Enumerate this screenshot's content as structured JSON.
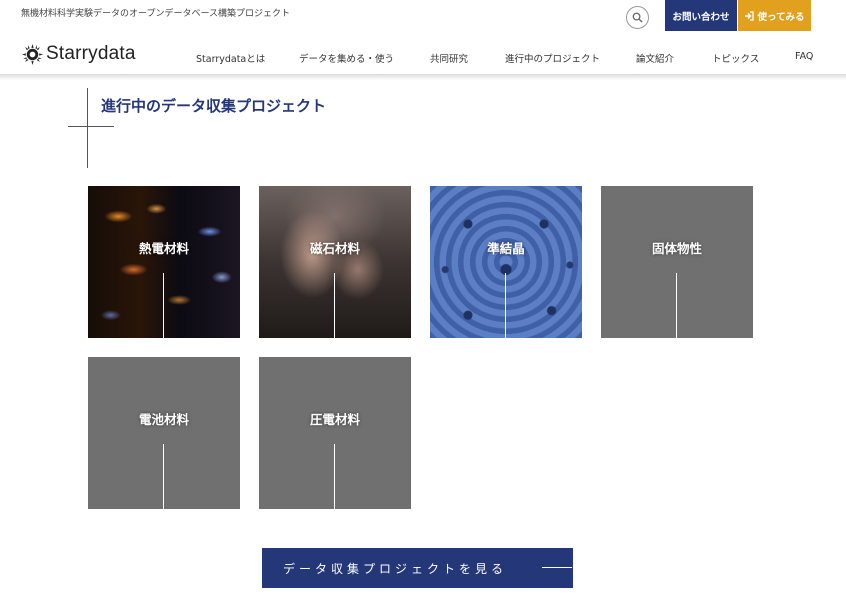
{
  "header": {
    "tagline": "無機材料科学実験データのオープンデータベース構築プロジェクト",
    "logo_text": "Starrydata",
    "search_icon": "search-icon",
    "contact_label": "お問い合わせ",
    "try_label": "使ってみる",
    "try_icon": "sign-in-icon",
    "colors": {
      "contact": "#243779",
      "try": "#e1a11f"
    }
  },
  "nav": {
    "items": [
      {
        "label": "Starrydataとは"
      },
      {
        "label": "データを集める・使う"
      },
      {
        "label": "共同研究"
      },
      {
        "label": "進行中のプロジェクト"
      },
      {
        "label": "論文紹介"
      },
      {
        "label": "トピックス"
      },
      {
        "label": "FAQ"
      }
    ]
  },
  "main": {
    "title": "進行中のデータ収集プロジェクト",
    "projects": [
      {
        "label": "熱電材料"
      },
      {
        "label": "磁石材料"
      },
      {
        "label": "準結晶"
      },
      {
        "label": "固体物性"
      },
      {
        "label": "電池材料"
      },
      {
        "label": "圧電材料"
      }
    ],
    "cta_label": "データ収集プロジェクトを見る"
  }
}
